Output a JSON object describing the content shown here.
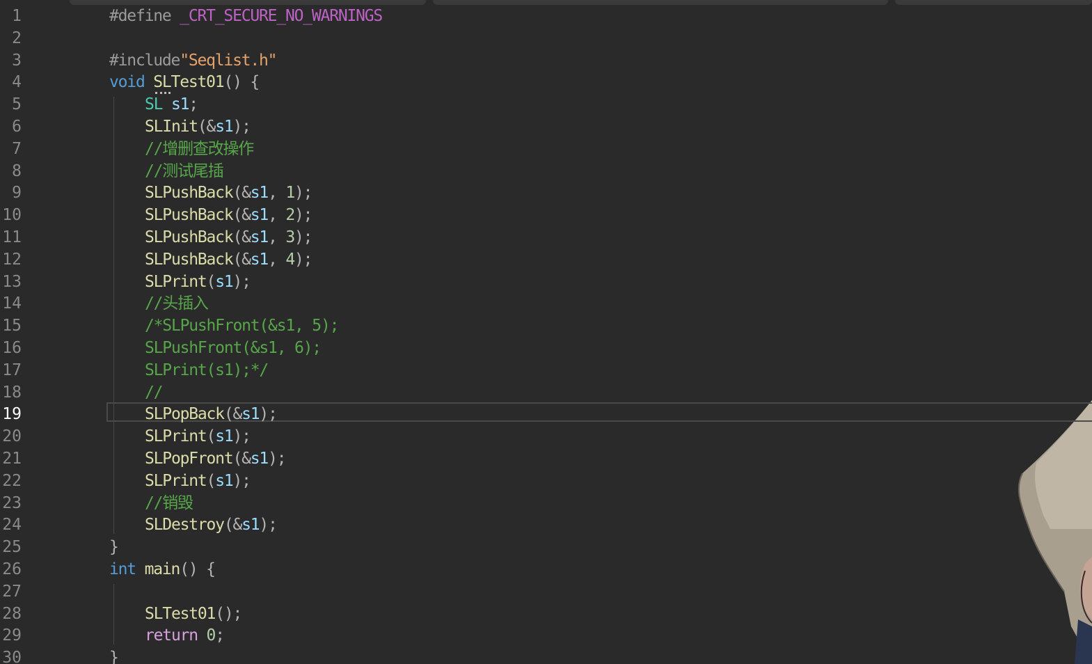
{
  "editor": {
    "active_line": 19,
    "lines": [
      {
        "n": "1",
        "tokens": [
          {
            "t": "#define ",
            "c": "pp"
          },
          {
            "t": "_CRT_SECURE_NO_WARNINGS",
            "c": "macro"
          }
        ],
        "indent": 0
      },
      {
        "n": "2",
        "tokens": [],
        "indent": 0
      },
      {
        "n": "3",
        "tokens": [
          {
            "t": "#include",
            "c": "pp"
          },
          {
            "t": "\"Seqlist.h\"",
            "c": "str"
          }
        ],
        "indent": 0
      },
      {
        "n": "4",
        "tokens": [
          {
            "t": "void ",
            "c": "kw"
          },
          {
            "t": "SLTest01",
            "c": "fn"
          },
          {
            "t": "() {",
            "c": "punc"
          }
        ],
        "indent": 0
      },
      {
        "n": "5",
        "tokens": [
          {
            "t": "SL ",
            "c": "type"
          },
          {
            "t": "s1",
            "c": "var"
          },
          {
            "t": ";",
            "c": "punc"
          }
        ],
        "indent": 1
      },
      {
        "n": "6",
        "tokens": [
          {
            "t": "SLInit",
            "c": "fn"
          },
          {
            "t": "(&",
            "c": "punc"
          },
          {
            "t": "s1",
            "c": "var"
          },
          {
            "t": ");",
            "c": "punc"
          }
        ],
        "indent": 1
      },
      {
        "n": "7",
        "tokens": [
          {
            "t": "//增删查改操作",
            "c": "com"
          }
        ],
        "indent": 1
      },
      {
        "n": "8",
        "tokens": [
          {
            "t": "//测试尾插",
            "c": "com"
          }
        ],
        "indent": 1
      },
      {
        "n": "9",
        "tokens": [
          {
            "t": "SLPushBack",
            "c": "fn"
          },
          {
            "t": "(&",
            "c": "punc"
          },
          {
            "t": "s1",
            "c": "var"
          },
          {
            "t": ", ",
            "c": "punc"
          },
          {
            "t": "1",
            "c": "num"
          },
          {
            "t": ");",
            "c": "punc"
          }
        ],
        "indent": 1
      },
      {
        "n": "10",
        "tokens": [
          {
            "t": "SLPushBack",
            "c": "fn"
          },
          {
            "t": "(&",
            "c": "punc"
          },
          {
            "t": "s1",
            "c": "var"
          },
          {
            "t": ", ",
            "c": "punc"
          },
          {
            "t": "2",
            "c": "num"
          },
          {
            "t": ");",
            "c": "punc"
          }
        ],
        "indent": 1
      },
      {
        "n": "11",
        "tokens": [
          {
            "t": "SLPushBack",
            "c": "fn"
          },
          {
            "t": "(&",
            "c": "punc"
          },
          {
            "t": "s1",
            "c": "var"
          },
          {
            "t": ", ",
            "c": "punc"
          },
          {
            "t": "3",
            "c": "num"
          },
          {
            "t": ");",
            "c": "punc"
          }
        ],
        "indent": 1
      },
      {
        "n": "12",
        "tokens": [
          {
            "t": "SLPushBack",
            "c": "fn"
          },
          {
            "t": "(&",
            "c": "punc"
          },
          {
            "t": "s1",
            "c": "var"
          },
          {
            "t": ", ",
            "c": "punc"
          },
          {
            "t": "4",
            "c": "num"
          },
          {
            "t": ");",
            "c": "punc"
          }
        ],
        "indent": 1
      },
      {
        "n": "13",
        "tokens": [
          {
            "t": "SLPrint",
            "c": "fn"
          },
          {
            "t": "(",
            "c": "punc"
          },
          {
            "t": "s1",
            "c": "var"
          },
          {
            "t": ");",
            "c": "punc"
          }
        ],
        "indent": 1
      },
      {
        "n": "14",
        "tokens": [
          {
            "t": "//头插入",
            "c": "com"
          }
        ],
        "indent": 1
      },
      {
        "n": "15",
        "tokens": [
          {
            "t": "/*SLPushFront(&s1, 5);",
            "c": "com"
          }
        ],
        "indent": 1
      },
      {
        "n": "16",
        "tokens": [
          {
            "t": "SLPushFront(&s1, 6);",
            "c": "com"
          }
        ],
        "indent": 1
      },
      {
        "n": "17",
        "tokens": [
          {
            "t": "SLPrint(s1);*/",
            "c": "com"
          }
        ],
        "indent": 1
      },
      {
        "n": "18",
        "tokens": [
          {
            "t": "//",
            "c": "com"
          }
        ],
        "indent": 1
      },
      {
        "n": "19",
        "tokens": [
          {
            "t": "SLPopBack",
            "c": "fn"
          },
          {
            "t": "(&",
            "c": "punc"
          },
          {
            "t": "s1",
            "c": "var"
          },
          {
            "t": ");",
            "c": "punc"
          }
        ],
        "indent": 1
      },
      {
        "n": "20",
        "tokens": [
          {
            "t": "SLPrint",
            "c": "fn"
          },
          {
            "t": "(",
            "c": "punc"
          },
          {
            "t": "s1",
            "c": "var"
          },
          {
            "t": ");",
            "c": "punc"
          }
        ],
        "indent": 1
      },
      {
        "n": "21",
        "tokens": [
          {
            "t": "SLPopFront",
            "c": "fn"
          },
          {
            "t": "(&",
            "c": "punc"
          },
          {
            "t": "s1",
            "c": "var"
          },
          {
            "t": ");",
            "c": "punc"
          }
        ],
        "indent": 1
      },
      {
        "n": "22",
        "tokens": [
          {
            "t": "SLPrint",
            "c": "fn"
          },
          {
            "t": "(",
            "c": "punc"
          },
          {
            "t": "s1",
            "c": "var"
          },
          {
            "t": ");",
            "c": "punc"
          }
        ],
        "indent": 1
      },
      {
        "n": "23",
        "tokens": [
          {
            "t": "//销毁",
            "c": "com"
          }
        ],
        "indent": 1
      },
      {
        "n": "24",
        "tokens": [
          {
            "t": "SLDestroy",
            "c": "fn"
          },
          {
            "t": "(&",
            "c": "punc"
          },
          {
            "t": "s1",
            "c": "var"
          },
          {
            "t": ");",
            "c": "punc"
          }
        ],
        "indent": 1
      },
      {
        "n": "25",
        "tokens": [
          {
            "t": "}",
            "c": "punc"
          }
        ],
        "indent": 0
      },
      {
        "n": "26",
        "tokens": [
          {
            "t": "int ",
            "c": "kw"
          },
          {
            "t": "main",
            "c": "fn"
          },
          {
            "t": "() {",
            "c": "punc"
          }
        ],
        "indent": 0
      },
      {
        "n": "27",
        "tokens": [],
        "indent": 1
      },
      {
        "n": "28",
        "tokens": [
          {
            "t": "SLTest01",
            "c": "fn"
          },
          {
            "t": "();",
            "c": "punc"
          }
        ],
        "indent": 1
      },
      {
        "n": "29",
        "tokens": [
          {
            "t": "return ",
            "c": "kwc"
          },
          {
            "t": "0",
            "c": "num"
          },
          {
            "t": ";",
            "c": "punc"
          }
        ],
        "indent": 1
      },
      {
        "n": "30",
        "tokens": [
          {
            "t": "}",
            "c": "punc"
          }
        ],
        "indent": 0
      }
    ]
  },
  "colors": {
    "background": "#2a2a2a",
    "line_number": "#8a8a8a",
    "active_line_number": "#ffffff",
    "comment": "#57a64a",
    "function": "#dcdcaa",
    "keyword": "#569cd6",
    "control_keyword": "#d8a0df",
    "type": "#4ec9b0",
    "variable": "#9cdcfe",
    "string": "#e4a26c",
    "macro": "#bd63c5",
    "number": "#b5cea8"
  },
  "background_art": "anime-character-illustration"
}
